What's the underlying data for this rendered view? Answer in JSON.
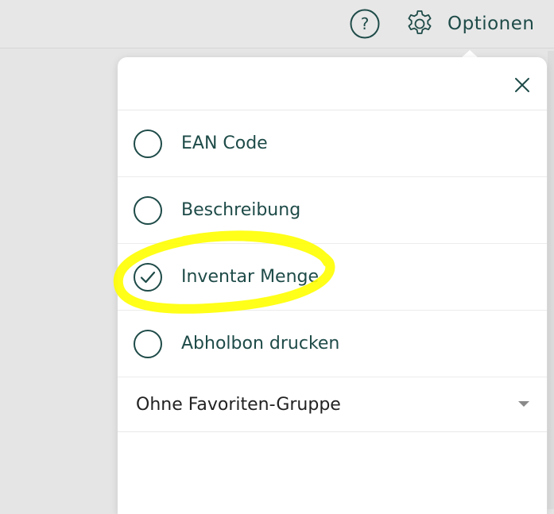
{
  "header": {
    "help_icon": "question-circle-icon",
    "options_icon": "gear-icon",
    "options_label": "Optionen"
  },
  "panel": {
    "close_icon": "close-icon",
    "options": [
      {
        "label": "EAN Code",
        "checked": false
      },
      {
        "label": "Beschreibung",
        "checked": false
      },
      {
        "label": "Inventar Menge",
        "checked": true
      },
      {
        "label": "Abholbon drucken",
        "checked": false
      }
    ],
    "favorites_select": {
      "value": "Ohne Favoriten-Gruppe"
    }
  },
  "annotation": {
    "color": "#ffff00"
  },
  "colors": {
    "accent": "#1e4b48"
  }
}
